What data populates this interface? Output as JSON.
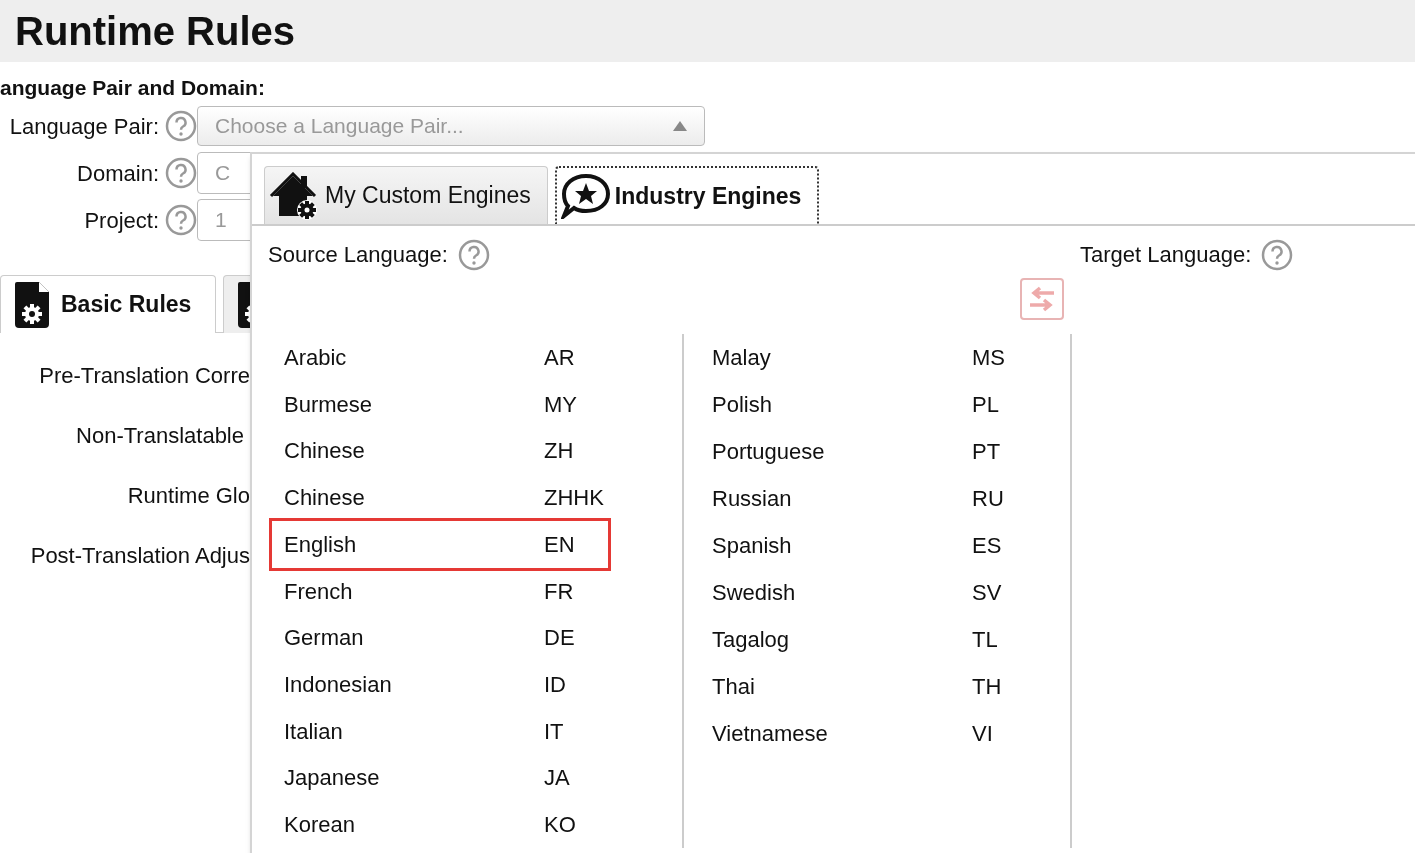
{
  "header": {
    "title": "Runtime Rules"
  },
  "section_label": "anguage Pair and Domain:",
  "form_rows": [
    {
      "label": "Language Pair:",
      "kind": "dropdown",
      "placeholder": "Choose a Language Pair..."
    },
    {
      "label": "Domain:",
      "kind": "partial",
      "value": "C"
    },
    {
      "label": "Project:",
      "kind": "partial",
      "value": "1"
    }
  ],
  "rule_tabs": [
    {
      "label": "Basic Rules",
      "selected": true
    },
    {
      "selected": false
    }
  ],
  "rules": [
    "Pre-Translation Corre",
    "Non-Translatable",
    "Runtime Glo",
    "Post-Translation Adjus"
  ],
  "dropdown": {
    "tabs": [
      {
        "label": "My Custom Engines",
        "kind": "house",
        "selected": false
      },
      {
        "label": "Industry Engines",
        "kind": "star",
        "selected": true
      }
    ],
    "source_label": "Source Language:",
    "target_label": "Target Language:",
    "columns": [
      [
        {
          "name": "Arabic",
          "code": "AR",
          "selected": false
        },
        {
          "name": "Burmese",
          "code": "MY",
          "selected": false
        },
        {
          "name": "Chinese",
          "code": "ZH",
          "selected": false
        },
        {
          "name": "Chinese",
          "code": "ZHHK",
          "selected": false
        },
        {
          "name": "English",
          "code": "EN",
          "selected": true
        },
        {
          "name": "French",
          "code": "FR",
          "selected": false
        },
        {
          "name": "German",
          "code": "DE",
          "selected": false
        },
        {
          "name": "Indonesian",
          "code": "ID",
          "selected": false
        },
        {
          "name": "Italian",
          "code": "IT",
          "selected": false
        },
        {
          "name": "Japanese",
          "code": "JA",
          "selected": false
        },
        {
          "name": "Korean",
          "code": "KO",
          "selected": false
        }
      ],
      [
        {
          "name": "Malay",
          "code": "MS",
          "selected": false
        },
        {
          "name": "Polish",
          "code": "PL",
          "selected": false
        },
        {
          "name": "Portuguese",
          "code": "PT",
          "selected": false
        },
        {
          "name": "Russian",
          "code": "RU",
          "selected": false
        },
        {
          "name": "Spanish",
          "code": "ES",
          "selected": false
        },
        {
          "name": "Swedish",
          "code": "SV",
          "selected": false
        },
        {
          "name": "Tagalog",
          "code": "TL",
          "selected": false
        },
        {
          "name": "Thai",
          "code": "TH",
          "selected": false
        },
        {
          "name": "Vietnamese",
          "code": "VI",
          "selected": false
        }
      ]
    ]
  }
}
